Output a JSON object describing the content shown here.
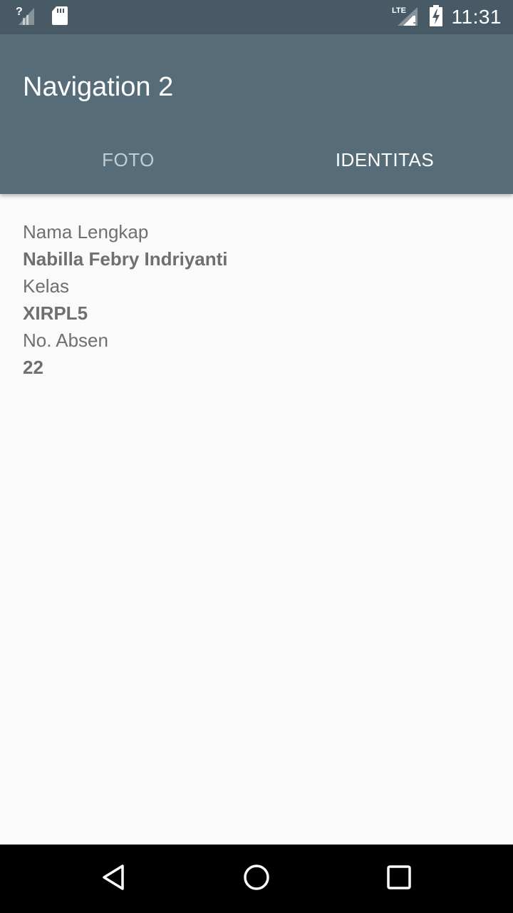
{
  "status_bar": {
    "time": "11:31",
    "icons": [
      "signal-unknown-icon",
      "sd-card-icon",
      "lte-signal-icon",
      "battery-charging-icon"
    ],
    "lte_label": "LTE"
  },
  "app_bar": {
    "title": "Navigation 2",
    "color": "#566d79"
  },
  "tabs": [
    {
      "label": "FOTO",
      "selected": false
    },
    {
      "label": "IDENTITAS",
      "selected": true
    }
  ],
  "identity": {
    "name_label": "Nama Lengkap",
    "name_value": "Nabilla Febry Indriyanti",
    "class_label": "Kelas",
    "class_value": "XIRPL5",
    "number_label": "No. Absen",
    "number_value": "22"
  },
  "nav_bar": {
    "icons": [
      "back-icon",
      "home-icon",
      "recents-icon"
    ]
  }
}
